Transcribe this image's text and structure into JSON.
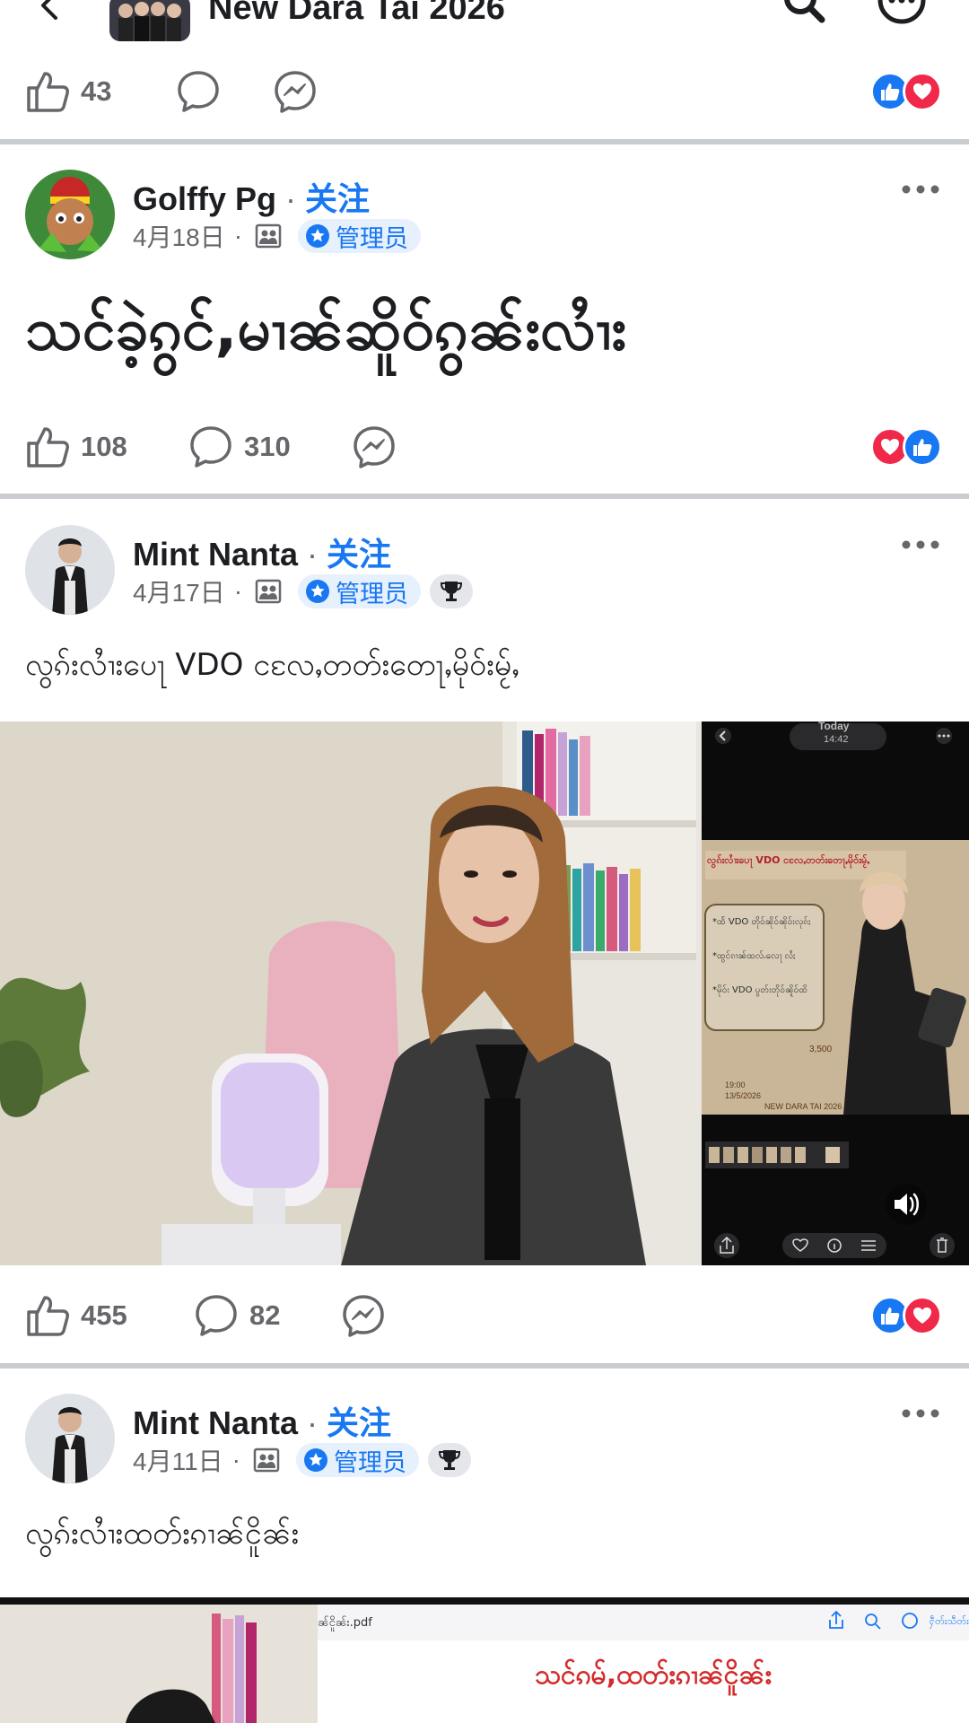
{
  "topbar": {
    "title": "New Dara Tai 2026"
  },
  "colors": {
    "accent": "#1877f2",
    "like": "#1877f2",
    "love": "#f0284a",
    "muted": "#65676b"
  },
  "post0": {
    "likes": "43"
  },
  "post1": {
    "author": "Golffy Pg",
    "separator": "·",
    "follow": "关注",
    "date": "4月18日",
    "meta_dot": "·",
    "badge": "管理员",
    "text": "သင်ခဲ့ၵွင်,မၢၼ်ဆိူဝ်ၵွၼ်းလၢႆး",
    "likes": "108",
    "comments": "310"
  },
  "post2": {
    "author": "Mint Nanta",
    "separator": "·",
    "follow": "关注",
    "date": "4月17日",
    "meta_dot": "·",
    "badge": "管理员",
    "text": "လွၵ်းလၢႆးပေႃ VDO ငလႄႇတတ်းတေႃႇမိုဝ်းမႂ်ႇ",
    "likes": "455",
    "comments": "82",
    "video": {
      "phone_header": "Today",
      "phone_time": "14:42",
      "poster_title": "လွၵ်းလၢႆးပေႃ VDO ငလႄႇတတ်းတေႃႇမိုဝ်းမႂ်ႇ",
      "poster_lines": [
        "*ထႅ VDO တိုဝ်ၼိုဝ်ၼိုဝ်းလုၵ်ႈ",
        "*ထွင်ၵၢၼ်ထလ်ႉလေႃ လႆႈ",
        "*မိုဝ်း VDO ပွတ်းတိုဝ်ၼိူဝ်ထိ"
      ],
      "poster_price": "3,500",
      "poster_date_1": "19:00",
      "poster_date_2": "13/5/2026",
      "poster_footer": "NEW DARA TAI 2026"
    }
  },
  "post3": {
    "author": "Mint Nanta",
    "separator": "·",
    "follow": "关注",
    "date": "4月11日",
    "meta_dot": "·",
    "badge": "管理员",
    "text": "လွၵ်းလၢႆးထတ်းၵၢၼ်ငိူၼ်း",
    "doc_filename": "ၼ်ငိူၼ်း.pdf",
    "doc_done": "ႁဵတ်းသဵတ်း",
    "doc_title": "သင်ၵမ်,ထတ်းၵၢၼ်ငိူၼ်း"
  }
}
